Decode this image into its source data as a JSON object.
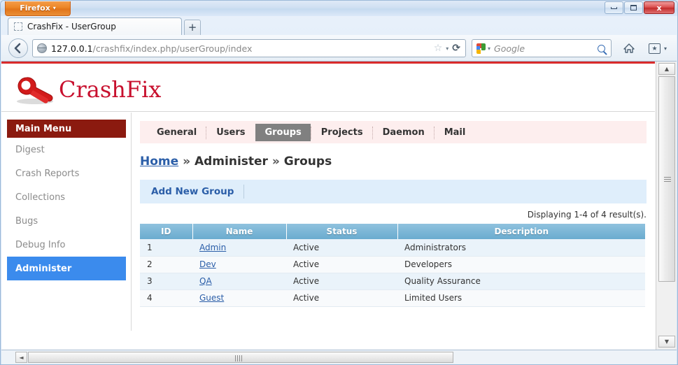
{
  "browser": {
    "app_button": "Firefox",
    "app_button_caret": "▾",
    "tab_title": "CrashFix - UserGroup",
    "new_tab_label": "+",
    "url_host": "127.0.0.1",
    "url_path": "/crashfix/index.php/userGroup/index",
    "search_placeholder": "Google",
    "reload_glyph": "⟳",
    "star_glyph": "☆",
    "dropdown_glyph": "▾",
    "back_glyph": "←",
    "home_glyph": "⌂",
    "bookmark_glyph": "★",
    "window_controls": {
      "minimize": "minimize",
      "maximize": "maximize",
      "close": "x"
    }
  },
  "site": {
    "logo_text": "CrashFix",
    "accent_red": "#c8102e",
    "top_rule_color": "#d92b2b"
  },
  "sidebar": {
    "header": "Main Menu",
    "items": [
      {
        "label": "Digest",
        "active": false
      },
      {
        "label": "Crash Reports",
        "active": false
      },
      {
        "label": "Collections",
        "active": false
      },
      {
        "label": "Bugs",
        "active": false
      },
      {
        "label": "Debug Info",
        "active": false
      },
      {
        "label": "Administer",
        "active": true
      }
    ],
    "header_color": "#8b1a0f",
    "active_color": "#3b8bed"
  },
  "tabs": [
    {
      "label": "General",
      "active": false
    },
    {
      "label": "Users",
      "active": false
    },
    {
      "label": "Groups",
      "active": true
    },
    {
      "label": "Projects",
      "active": false
    },
    {
      "label": "Daemon",
      "active": false
    },
    {
      "label": "Mail",
      "active": false
    }
  ],
  "breadcrumb": {
    "home": "Home",
    "separator": "»",
    "middle": "Administer",
    "current": "Groups"
  },
  "actionbar": {
    "add_new_group": "Add New Group"
  },
  "summary": "Displaying 1-4 of 4 result(s).",
  "table": {
    "columns": [
      "ID",
      "Name",
      "Status",
      "Description"
    ],
    "rows": [
      {
        "id": "1",
        "name": "Admin",
        "status": "Active",
        "description": "Administrators"
      },
      {
        "id": "2",
        "name": "Dev",
        "status": "Active",
        "description": "Developers"
      },
      {
        "id": "3",
        "name": "QA",
        "status": "Active",
        "description": "Quality Assurance"
      },
      {
        "id": "4",
        "name": "Guest",
        "status": "Active",
        "description": "Limited Users"
      }
    ]
  },
  "scrollbars": {
    "up_glyph": "▲",
    "down_glyph": "▼",
    "left_glyph": "◄"
  }
}
